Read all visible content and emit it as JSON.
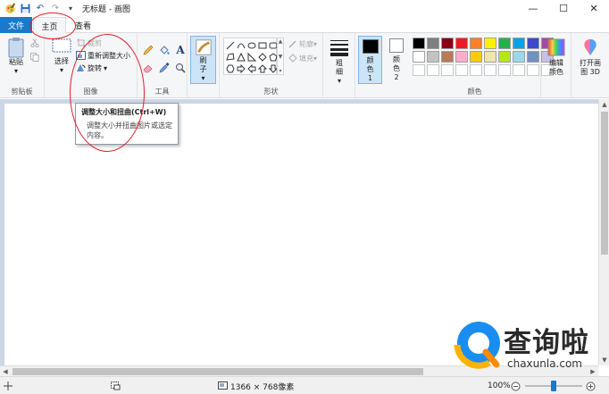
{
  "window": {
    "title": "无标题 - 画图",
    "minimize": "—",
    "maximize": "☐",
    "close": "✕"
  },
  "qat": {
    "save": "💾",
    "undo": "↶",
    "redo": "↷",
    "customize": "▾"
  },
  "tabs": {
    "file": "文件",
    "home": "主页",
    "view": "查看"
  },
  "clipboard": {
    "paste": "粘贴",
    "group": "剪贴板"
  },
  "image": {
    "select": "选择",
    "crop": "裁剪",
    "resize": "重新调整大小",
    "rotate": "旋转",
    "group": "图像"
  },
  "tools": {
    "group": "工具",
    "text_tool": "A"
  },
  "brushes": {
    "label": "刷子"
  },
  "shapes": {
    "outline": "轮廓",
    "fill": "填充",
    "group": "形状"
  },
  "size": {
    "label": "粗细"
  },
  "colors": {
    "color1": "颜色 1",
    "color2": "颜色 2",
    "edit": "编辑颜色",
    "group": "颜色",
    "color1_value": "#000000",
    "color2_value": "#ffffff",
    "palette": [
      "#000000",
      "#7f7f7f",
      "#880015",
      "#ed1c24",
      "#ff7f27",
      "#fff200",
      "#22b14c",
      "#00a2e8",
      "#3f48cc",
      "#a349a4",
      "#ffffff",
      "#c3c3c3",
      "#b97a57",
      "#ffaec9",
      "#ffc90e",
      "#efe4b0",
      "#b5e61d",
      "#99d9ea",
      "#7092be",
      "#c8bfe7"
    ],
    "accent": "#1979ca"
  },
  "paint3d": {
    "label": "打开画图 3D"
  },
  "tooltip": {
    "title": "调整大小和扭曲(Ctrl+W)",
    "body": "调整大小并扭曲图片或选定内容。"
  },
  "status": {
    "dimensions": "1366 × 768像素",
    "zoom": "100%",
    "zoom_level": 0.5
  },
  "watermark": {
    "brand": "查询啦",
    "domain": "chaxunla.com"
  },
  "annotation_color": "#e0202a"
}
